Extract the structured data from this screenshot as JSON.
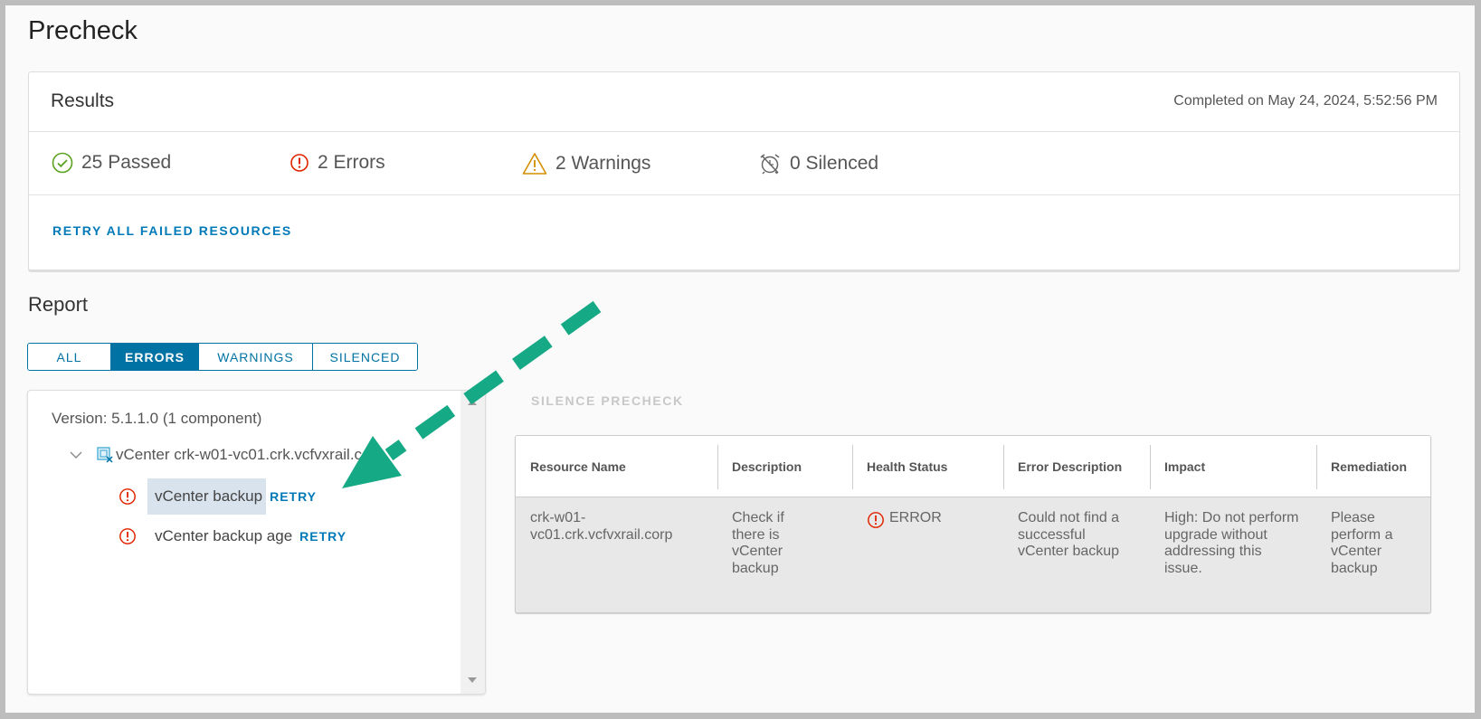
{
  "page_title": "Precheck",
  "results": {
    "heading": "Results",
    "completed": "Completed on May 24, 2024, 5:52:56 PM",
    "stats": [
      {
        "icon": "check-circle-icon",
        "label": "25 Passed",
        "color": "#5aa220"
      },
      {
        "icon": "error-circle-icon",
        "label": "2 Errors",
        "color": "#e12200"
      },
      {
        "icon": "warning-triangle-icon",
        "label": "2 Warnings",
        "color": "#d28f00"
      },
      {
        "icon": "silenced-alarm-icon",
        "label": "0 Silenced",
        "color": "#666666"
      }
    ],
    "retry_all": "RETRY ALL FAILED RESOURCES"
  },
  "report": {
    "heading": "Report",
    "tabs": [
      {
        "label": "ALL",
        "active": false
      },
      {
        "label": "ERRORS",
        "active": true
      },
      {
        "label": "WARNINGS",
        "active": false
      },
      {
        "label": "SILENCED",
        "active": false
      }
    ],
    "tree": {
      "version": "Version: 5.1.1.0 (1 component)",
      "node": "vCenter crk-w01-vc01.crk.vcfvxrail.corp",
      "items": [
        {
          "label": "vCenter backup",
          "retry": "RETRY",
          "selected": true
        },
        {
          "label": "vCenter backup age",
          "retry": "RETRY",
          "selected": false
        }
      ]
    },
    "silence_label": "SILENCE PRECHECK",
    "table": {
      "headers": [
        "Resource Name",
        "Description",
        "Health Status",
        "Error Description",
        "Impact",
        "Remediation"
      ],
      "row": {
        "resource": "crk-w01-vc01.crk.vcfvxrail.corp",
        "description": "Check if there is vCenter backup",
        "status": "ERROR",
        "error_description": "Could not find a successful vCenter backup",
        "impact": "High: Do not perform upgrade without addressing this issue.",
        "remediation": "Please perform a vCenter backup"
      }
    }
  },
  "colors": {
    "accent": "#0072a3",
    "link": "#0079b8",
    "error": "#e12200",
    "annotation_arrow": "#16a986"
  }
}
